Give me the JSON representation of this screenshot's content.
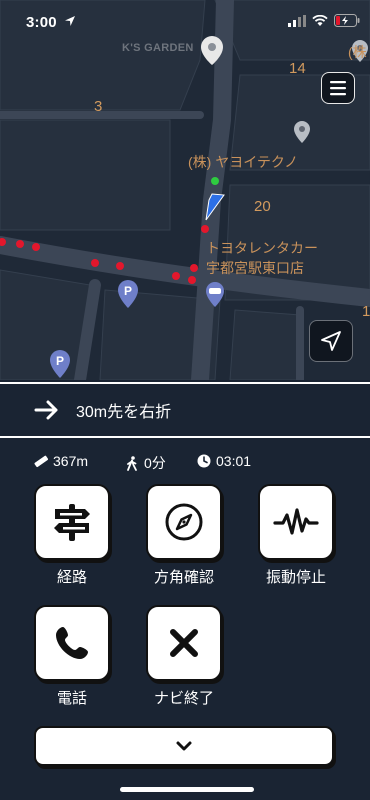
{
  "status_bar": {
    "time": "3:00"
  },
  "map": {
    "poi_garden": "K'S GARDEN",
    "poi_company": "(株) ヤヨイテクノ",
    "poi_edge": "(株",
    "rental_line1": "トヨタレンタカー",
    "rental_line2": "宇都宮駅東口店",
    "block_numbers": {
      "b3": "3",
      "b14": "14",
      "b20": "20",
      "b1": "1"
    },
    "parking_label": "P"
  },
  "instruction": {
    "text": "30m先を右折"
  },
  "stats": {
    "distance": "367m",
    "walk_time": "0分",
    "arrival": "03:01"
  },
  "actions": {
    "route": "経路",
    "compass": "方角確認",
    "vibration_stop": "振動停止",
    "phone": "電話",
    "end_navi": "ナビ終了"
  }
}
